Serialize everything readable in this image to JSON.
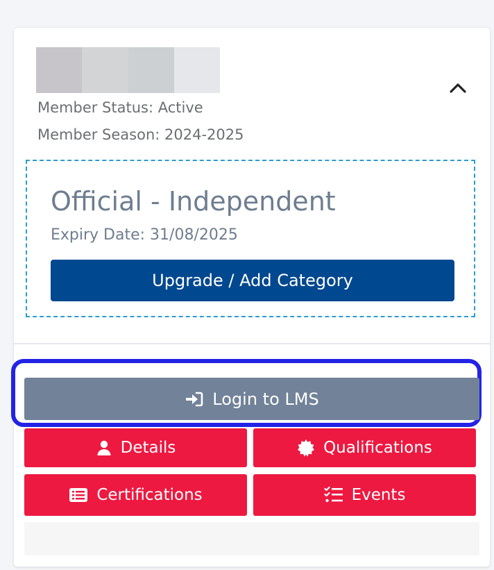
{
  "member": {
    "status": "Member Status: Active",
    "season": "Member Season: 2024-2025"
  },
  "category": {
    "title": "Official - Independent",
    "expiry": "Expiry Date: 31/08/2025",
    "upgrade_label": "Upgrade / Add Category"
  },
  "actions": {
    "lms_label": "Login to LMS",
    "details_label": "Details",
    "qualifications_label": "Qualifications",
    "certifications_label": "Certifications",
    "events_label": "Events"
  },
  "colors": {
    "primary_blue": "#004890",
    "lms_gray": "#718299",
    "action_red": "#ed1941",
    "dashed_border": "#2a9cd6",
    "highlight": "#2323e6"
  },
  "icons": {
    "collapse": "chevron-up-icon",
    "lms": "sign-in-icon",
    "details": "user-icon",
    "qualifications": "certificate-seal-icon",
    "certifications": "list-card-icon",
    "events": "checklist-icon"
  }
}
